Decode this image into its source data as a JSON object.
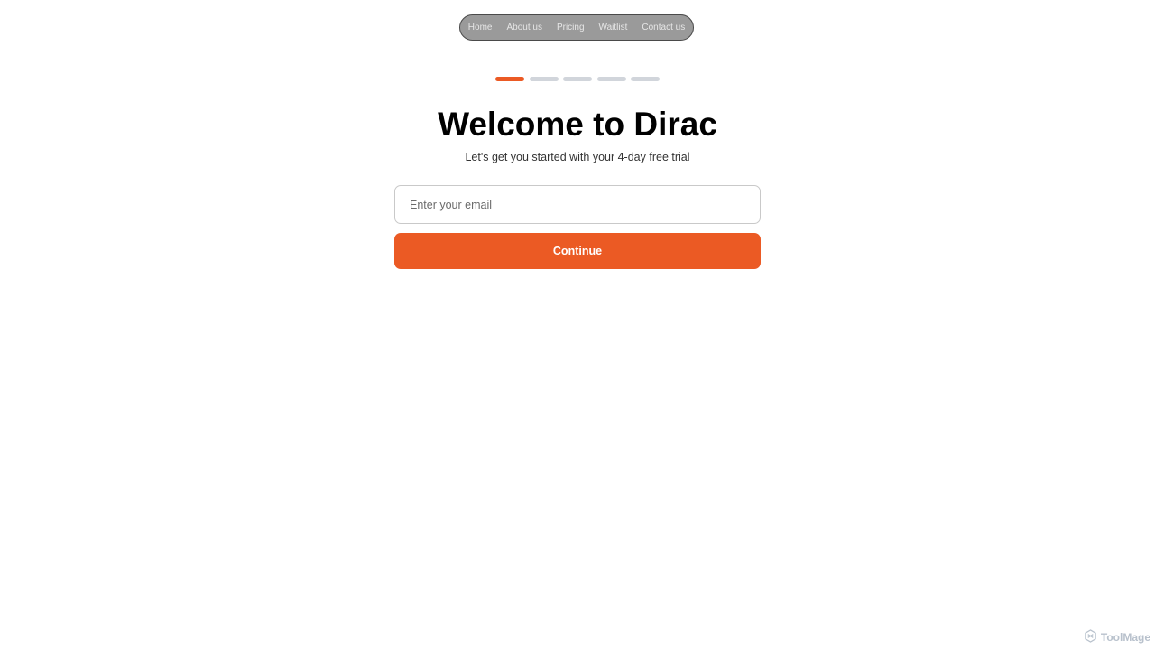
{
  "nav": {
    "items": [
      {
        "label": "Home"
      },
      {
        "label": "About us"
      },
      {
        "label": "Pricing"
      },
      {
        "label": "Waitlist"
      },
      {
        "label": "Contact us"
      }
    ]
  },
  "progress": {
    "total_steps": 5,
    "current_step": 1
  },
  "main": {
    "title": "Welcome to Dirac",
    "subtitle": "Let's get you started with your 4-day free trial",
    "email": {
      "value": "",
      "placeholder": "Enter your email"
    },
    "continue_label": "Continue"
  },
  "watermark": {
    "icon": "toolmage-logo-icon",
    "label": "ToolMage"
  },
  "colors": {
    "accent": "#eb5a24",
    "progress_inactive": "#d1d5db",
    "nav_background": "#9a9a9a"
  }
}
